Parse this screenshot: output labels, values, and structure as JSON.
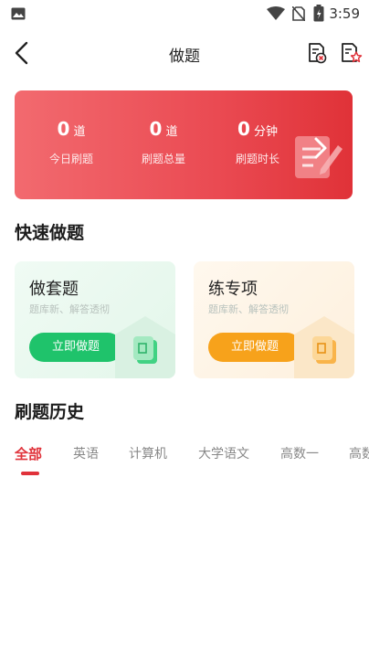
{
  "status_bar": {
    "time": "3:59"
  },
  "header": {
    "title": "做题"
  },
  "stats": [
    {
      "value": "0",
      "unit": "道",
      "label": "今日刷题"
    },
    {
      "value": "0",
      "unit": "道",
      "label": "刷题总量"
    },
    {
      "value": "0",
      "unit": "分钟",
      "label": "刷题时长"
    }
  ],
  "quick": {
    "heading": "快速做题",
    "cards": [
      {
        "title": "做套题",
        "subtitle": "题库新、解答透彻",
        "button": "立即做题",
        "accent": "#1fc36b"
      },
      {
        "title": "练专项",
        "subtitle": "题库新、解答透彻",
        "button": "立即做题",
        "accent": "#f7a21b"
      }
    ]
  },
  "history": {
    "heading": "刷题历史",
    "tabs": [
      "全部",
      "英语",
      "计算机",
      "大学语文",
      "高数一",
      "高数"
    ],
    "active_tab": "全部"
  },
  "colors": {
    "primary": "#e0323a",
    "green": "#1fc36b",
    "orange": "#f7a21b"
  }
}
